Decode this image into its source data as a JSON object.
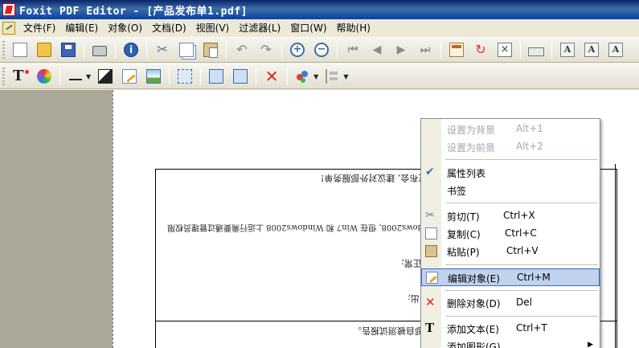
{
  "window": {
    "title": "Foxit PDF Editor - [产品发布单1.pdf]"
  },
  "menubar": {
    "items": [
      "文件(F)",
      "编辑(E)",
      "对象(O)",
      "文档(D)",
      "视图(V)",
      "过滤器(L)",
      "窗口(W)",
      "帮助(H)"
    ]
  },
  "toolbar1": {
    "icons": [
      "new-file-icon",
      "open-folder-icon",
      "save-icon",
      "print-icon",
      "info-icon",
      "cut-icon",
      "copy-icon",
      "paste-icon",
      "undo-icon",
      "redo-icon",
      "zoom-in-icon",
      "zoom-out-icon",
      "first-page-icon",
      "prev-page-icon",
      "next-page-icon",
      "last-page-icon",
      "page-properties-icon",
      "rotate-page-icon",
      "delete-page-icon",
      "keyboard-icon",
      "text-size-icon",
      "text-spacing-icon",
      "text-scale-icon"
    ]
  },
  "toolbar2": {
    "icons": [
      "add-text-icon",
      "color-icon",
      "line-style-icon",
      "fill-icon",
      "edit-object-icon",
      "add-image-icon",
      "select-object-icon",
      "distribute-icon",
      "delete-object-icon",
      "group-icon",
      "align-icon"
    ]
  },
  "document": {
    "lines": [
      "盛发布会, 建议对外部服务单!",
      "7、Windows2008, 但在 Win7 和 Windows2008 上运行需要通过管理员权限",
      "正常;",
      "出;",
      "清问题部自被测试报告。"
    ]
  },
  "context_menu": {
    "items": [
      {
        "label": "设置为背景",
        "shortcut": "Alt+1",
        "enabled": false
      },
      {
        "label": "设置为前景",
        "shortcut": "Alt+2",
        "enabled": false
      },
      {
        "label": "属性列表",
        "shortcut": "",
        "enabled": true,
        "checked": true
      },
      {
        "label": "书签",
        "shortcut": "",
        "enabled": true
      },
      {
        "label": "剪切(T)",
        "shortcut": "Ctrl+X",
        "enabled": true
      },
      {
        "label": "复制(C)",
        "shortcut": "Ctrl+C",
        "enabled": true
      },
      {
        "label": "粘贴(P)",
        "shortcut": "Ctrl+V",
        "enabled": true
      },
      {
        "label": "编辑对象(E)",
        "shortcut": "Ctrl+M",
        "enabled": true,
        "highlighted": true
      },
      {
        "label": "删除对象(D)",
        "shortcut": "Del",
        "enabled": true
      },
      {
        "label": "添加文本(E)",
        "shortcut": "Ctrl+T",
        "enabled": true
      },
      {
        "label": "添加图形(G)",
        "shortcut": "",
        "enabled": true,
        "submenu": true
      }
    ]
  },
  "colors": {
    "titlebar": "#0a246a",
    "menu_highlight": "#c1d2ee",
    "workspace": "#aca899"
  }
}
